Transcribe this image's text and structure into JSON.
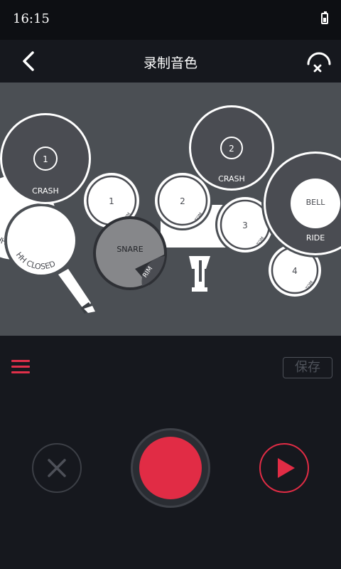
{
  "status_bar": {
    "time": "16:15"
  },
  "header": {
    "title": "录制音色",
    "back_icon": "back-arrow-icon",
    "right_icon": "audio-close-icon"
  },
  "drum_kit": {
    "crash_left": {
      "number": "1",
      "label": "CRASH"
    },
    "crash_right": {
      "number": "2",
      "label": "CRASH"
    },
    "hh_open": {
      "label": "HH OPEN"
    },
    "hh_closed": {
      "label": "HH CLOSED"
    },
    "tom1": {
      "number": "1",
      "sub": "TOM"
    },
    "tom2": {
      "number": "2",
      "sub": "TOM"
    },
    "tom3": {
      "number": "3",
      "sub": "TOM"
    },
    "tom4": {
      "number": "4",
      "sub": "TOM"
    },
    "snare": {
      "label": "SNARE",
      "rim": "RIM"
    },
    "ride": {
      "bell": "BELL",
      "label": "RIDE"
    }
  },
  "controls": {
    "save_label": "保存",
    "menu_icon": "menu-icon",
    "cancel_icon": "close-icon",
    "record_icon": "record-icon",
    "play_icon": "play-icon"
  },
  "colors": {
    "accent": "#e12c45",
    "background": "#16181e",
    "pad_area": "#4b4f54",
    "cymbal": "#4a4c52"
  }
}
